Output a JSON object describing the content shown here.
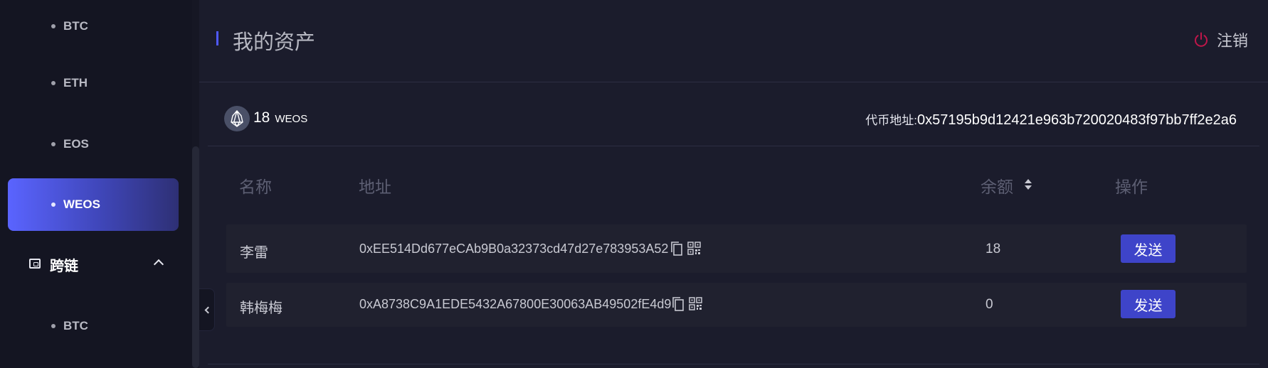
{
  "sidebar": {
    "items": [
      {
        "label": "BTC"
      },
      {
        "label": "ETH"
      },
      {
        "label": "EOS"
      },
      {
        "label": "WEOS"
      }
    ],
    "group": {
      "label": "跨链"
    },
    "sub_items": [
      {
        "label": "BTC"
      }
    ]
  },
  "header": {
    "title": "我的资产",
    "logout_label": "注销"
  },
  "asset": {
    "balance": "18",
    "unit": "WEOS",
    "address_label": "代币地址:",
    "address": "0x57195b9d12421e963b720020483f97bb7ff2e2a6"
  },
  "table": {
    "columns": [
      "名称",
      "地址",
      "余额",
      "操作"
    ],
    "rows": [
      {
        "name": "李雷",
        "address": "0xEE514Dd677eCAb9B0a32373cd47d27e783953A52",
        "balance": "18",
        "action": "发送"
      },
      {
        "name": "韩梅梅",
        "address": "0xA8738C9A1EDE5432A67800E30063AB49502fE4d9",
        "balance": "0",
        "action": "发送"
      }
    ]
  },
  "colors": {
    "accent": "#4f59ff",
    "active_gradient_start": "#5a64ff",
    "button": "#3e44c9",
    "logout_icon": "#c0164a"
  }
}
